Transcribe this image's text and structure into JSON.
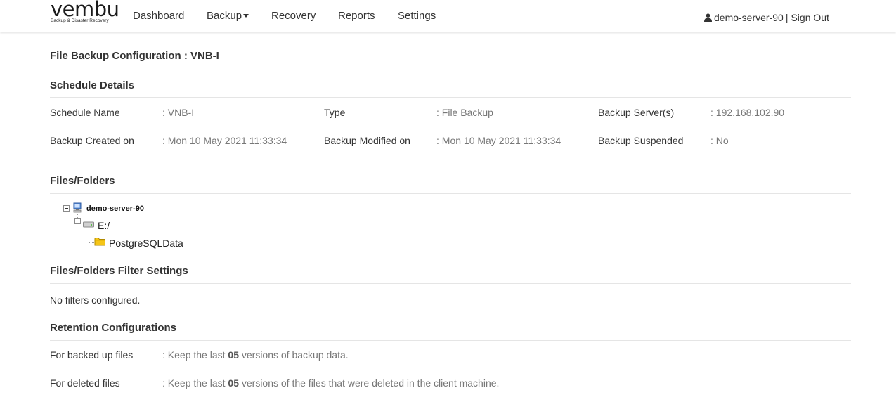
{
  "nav": {
    "logo_text": "vembu",
    "logo_subtitle": "Backup & Disaster Recovery",
    "items": [
      {
        "label": "Dashboard"
      },
      {
        "label": "Backup"
      },
      {
        "label": "Recovery"
      },
      {
        "label": "Reports"
      },
      {
        "label": "Settings"
      }
    ],
    "user": "demo-server-90",
    "separator": "|",
    "signout": "Sign Out"
  },
  "page": {
    "title": "File Backup Configuration : VNB-I"
  },
  "schedule": {
    "title": "Schedule Details",
    "fields": [
      {
        "label": "Schedule Name",
        "value": ": VNB-I"
      },
      {
        "label": "Type",
        "value": ": File Backup"
      },
      {
        "label": "Backup Server(s)",
        "value": ": 192.168.102.90"
      },
      {
        "label": "Backup Created on",
        "value": ": Mon 10 May 2021 11:33:34"
      },
      {
        "label": "Backup Modified on",
        "value": ": Mon 10 May 2021 11:33:34"
      },
      {
        "label": "Backup Suspended",
        "value": ": No"
      }
    ]
  },
  "files": {
    "title": "Files/Folders",
    "tree": {
      "server": "demo-server-90",
      "drive": "E:/",
      "folder": "PostgreSQLData"
    }
  },
  "filters": {
    "title": "Files/Folders Filter Settings",
    "text": "No filters configured."
  },
  "retention": {
    "title": "Retention Configurations",
    "rows": [
      {
        "label": "For backed up files",
        "prefix": ": Keep the last ",
        "count": "05",
        "suffix": " versions of backup data."
      },
      {
        "label": "For deleted files",
        "prefix": ": Keep the last ",
        "count": "05",
        "suffix": " versions of the files that were deleted in the client machine."
      }
    ]
  },
  "colors": {
    "accent": "#333333",
    "value_text": "#777777",
    "folder": "#f5c518"
  }
}
